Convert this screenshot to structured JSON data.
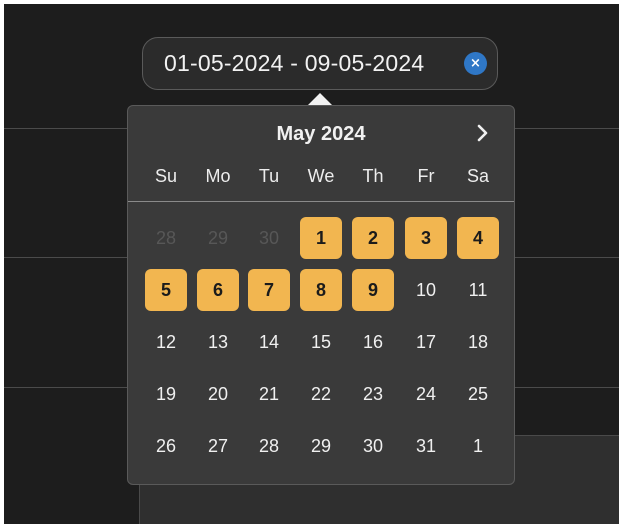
{
  "date_range": {
    "value": "01-05-2024 - 09-05-2024",
    "clear_icon": "×"
  },
  "calendar": {
    "month_label": "May 2024",
    "weekdays": [
      "Su",
      "Mo",
      "Tu",
      "We",
      "Th",
      "Fr",
      "Sa"
    ],
    "weeks": [
      [
        {
          "d": "28",
          "muted": true
        },
        {
          "d": "29",
          "muted": true
        },
        {
          "d": "30",
          "muted": true
        },
        {
          "d": "1",
          "selected": true
        },
        {
          "d": "2",
          "selected": true
        },
        {
          "d": "3",
          "selected": true
        },
        {
          "d": "4",
          "selected": true
        }
      ],
      [
        {
          "d": "5",
          "selected": true
        },
        {
          "d": "6",
          "selected": true
        },
        {
          "d": "7",
          "selected": true
        },
        {
          "d": "8",
          "selected": true
        },
        {
          "d": "9",
          "selected": true
        },
        {
          "d": "10"
        },
        {
          "d": "11"
        }
      ],
      [
        {
          "d": "12"
        },
        {
          "d": "13"
        },
        {
          "d": "14"
        },
        {
          "d": "15"
        },
        {
          "d": "16"
        },
        {
          "d": "17"
        },
        {
          "d": "18"
        }
      ],
      [
        {
          "d": "19"
        },
        {
          "d": "20"
        },
        {
          "d": "21"
        },
        {
          "d": "22"
        },
        {
          "d": "23"
        },
        {
          "d": "24"
        },
        {
          "d": "25"
        }
      ],
      [
        {
          "d": "26"
        },
        {
          "d": "27"
        },
        {
          "d": "28"
        },
        {
          "d": "29"
        },
        {
          "d": "30"
        },
        {
          "d": "31"
        },
        {
          "d": "1"
        }
      ]
    ],
    "selection_color": "#f2b650"
  },
  "icons": {
    "clear": "close-icon",
    "next": "chevron-right-icon"
  }
}
